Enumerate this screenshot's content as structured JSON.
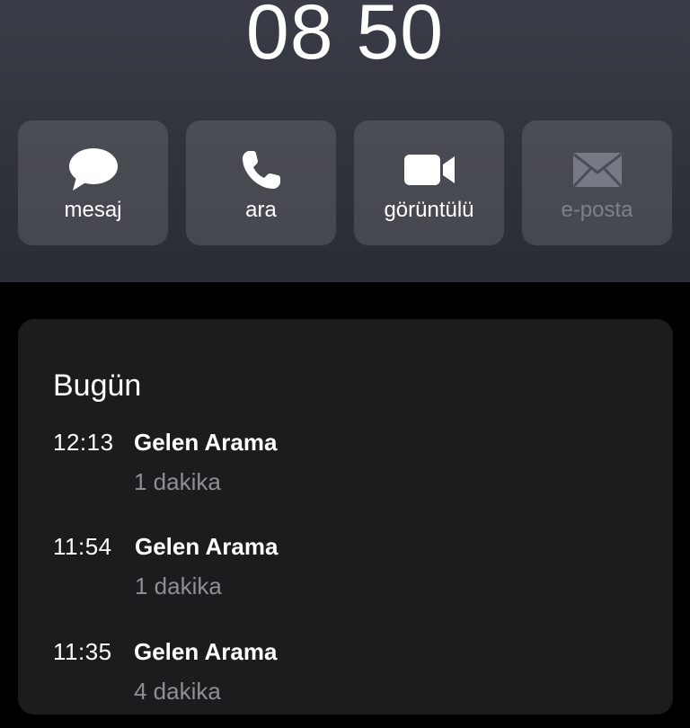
{
  "header": {
    "clock": "08 50"
  },
  "actions": [
    {
      "label": "mesaj",
      "icon": "message-bubble-icon",
      "enabled": true
    },
    {
      "label": "ara",
      "icon": "phone-icon",
      "enabled": true
    },
    {
      "label": "görüntülü",
      "icon": "video-camera-icon",
      "enabled": true
    },
    {
      "label": "e-posta",
      "icon": "envelope-icon",
      "enabled": false
    }
  ],
  "history": {
    "title": "Bugün",
    "calls": [
      {
        "time": "12:13",
        "type": "Gelen Arama",
        "duration": "1 dakika"
      },
      {
        "time": "11:54",
        "type": "Gelen Arama",
        "duration": "1 dakika"
      },
      {
        "time": "11:35",
        "type": "Gelen Arama",
        "duration": "4 dakika"
      }
    ]
  },
  "colors": {
    "header_bg": "#30333c",
    "button_bg": "#4a4d57",
    "card_bg": "#1c1c1e",
    "secondary_text": "#8e8e93",
    "disabled_text": "#7d808a"
  }
}
